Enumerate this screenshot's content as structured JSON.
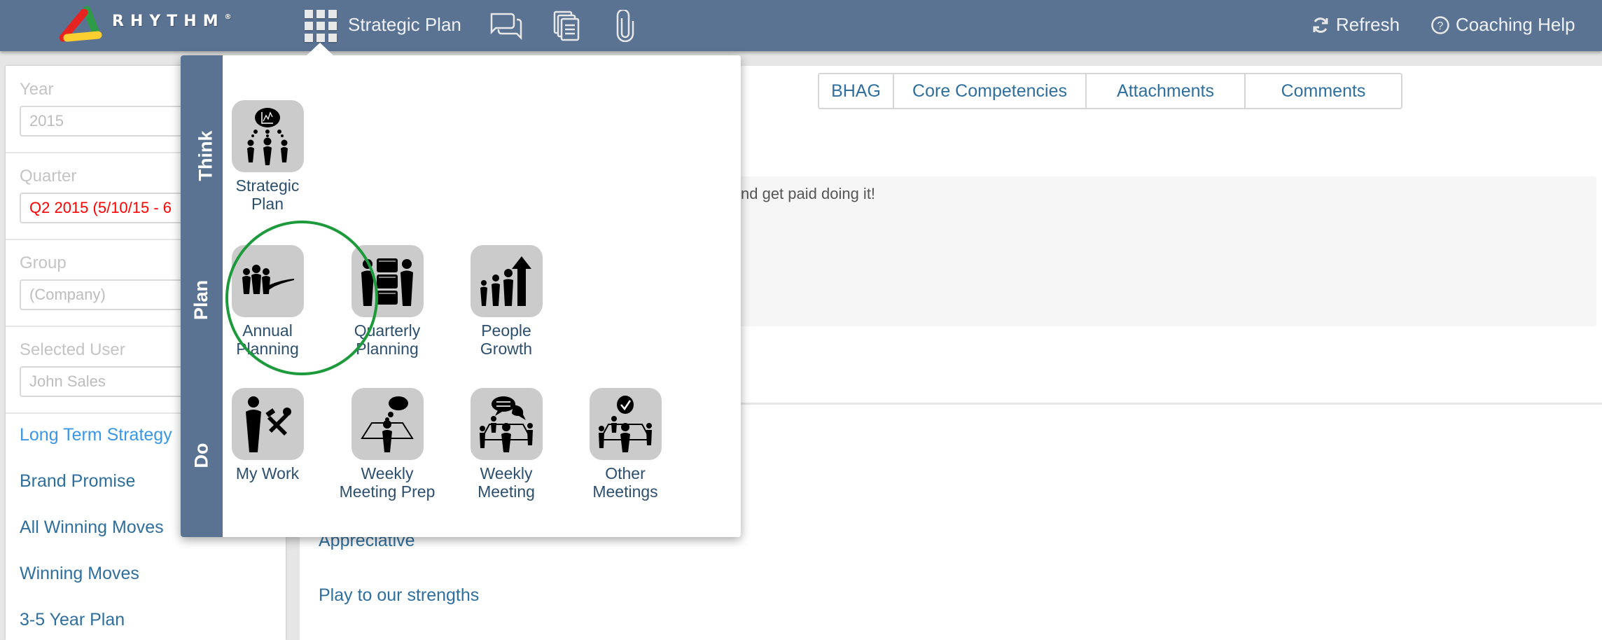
{
  "header": {
    "brand": "RHYTHM",
    "brand_mark": "®",
    "current_app": "Strategic Plan",
    "icons": [
      "apps-grid-icon",
      "comments-icon",
      "documents-icon",
      "paperclip-icon"
    ],
    "refresh_label": "Refresh",
    "help_label": "Coaching Help",
    "bg_color": "#5b7393"
  },
  "sidebar": {
    "fields": [
      {
        "label": "Year",
        "value": "2015"
      },
      {
        "label": "Quarter",
        "value": "Q2 2015 (5/10/15 - 6"
      },
      {
        "label": "Group",
        "value": "(Company)"
      },
      {
        "label": "Selected User",
        "value": "John Sales"
      }
    ],
    "quarter_value_color": "#ff0000",
    "nav": [
      {
        "label": "Long Term Strategy",
        "active": true
      },
      {
        "label": "Brand Promise"
      },
      {
        "label": "All Winning Moves"
      },
      {
        "label": "Winning Moves"
      },
      {
        "label": "3-5 Year Plan"
      }
    ]
  },
  "main": {
    "tabs": [
      "BHAG",
      "Core Competencies",
      "Attachments",
      "Comments"
    ],
    "description_visible": "nd get paid doing it!",
    "values": [
      "Appreciative",
      "Play to our strengths"
    ]
  },
  "app_menu": {
    "sections": [
      "Think",
      "Plan",
      "Do"
    ],
    "apps": {
      "think": [
        {
          "label1": "Strategic",
          "label2": "Plan",
          "icon": "strategic-plan-icon"
        }
      ],
      "plan": [
        {
          "label1": "Annual",
          "label2": "Planning",
          "icon": "annual-planning-icon",
          "highlighted": true
        },
        {
          "label1": "Quarterly",
          "label2": "Planning",
          "icon": "quarterly-planning-icon"
        },
        {
          "label1": "People",
          "label2": "Growth",
          "icon": "people-growth-icon"
        }
      ],
      "do": [
        {
          "label1": "My Work",
          "label2": "",
          "icon": "my-work-icon"
        },
        {
          "label1": "Weekly",
          "label2": "Meeting Prep",
          "icon": "weekly-meeting-prep-icon"
        },
        {
          "label1": "Weekly",
          "label2": "Meeting",
          "icon": "weekly-meeting-icon"
        },
        {
          "label1": "Other",
          "label2": "Meetings",
          "icon": "other-meetings-icon"
        }
      ]
    },
    "highlight_color": "#1d9a3c"
  }
}
